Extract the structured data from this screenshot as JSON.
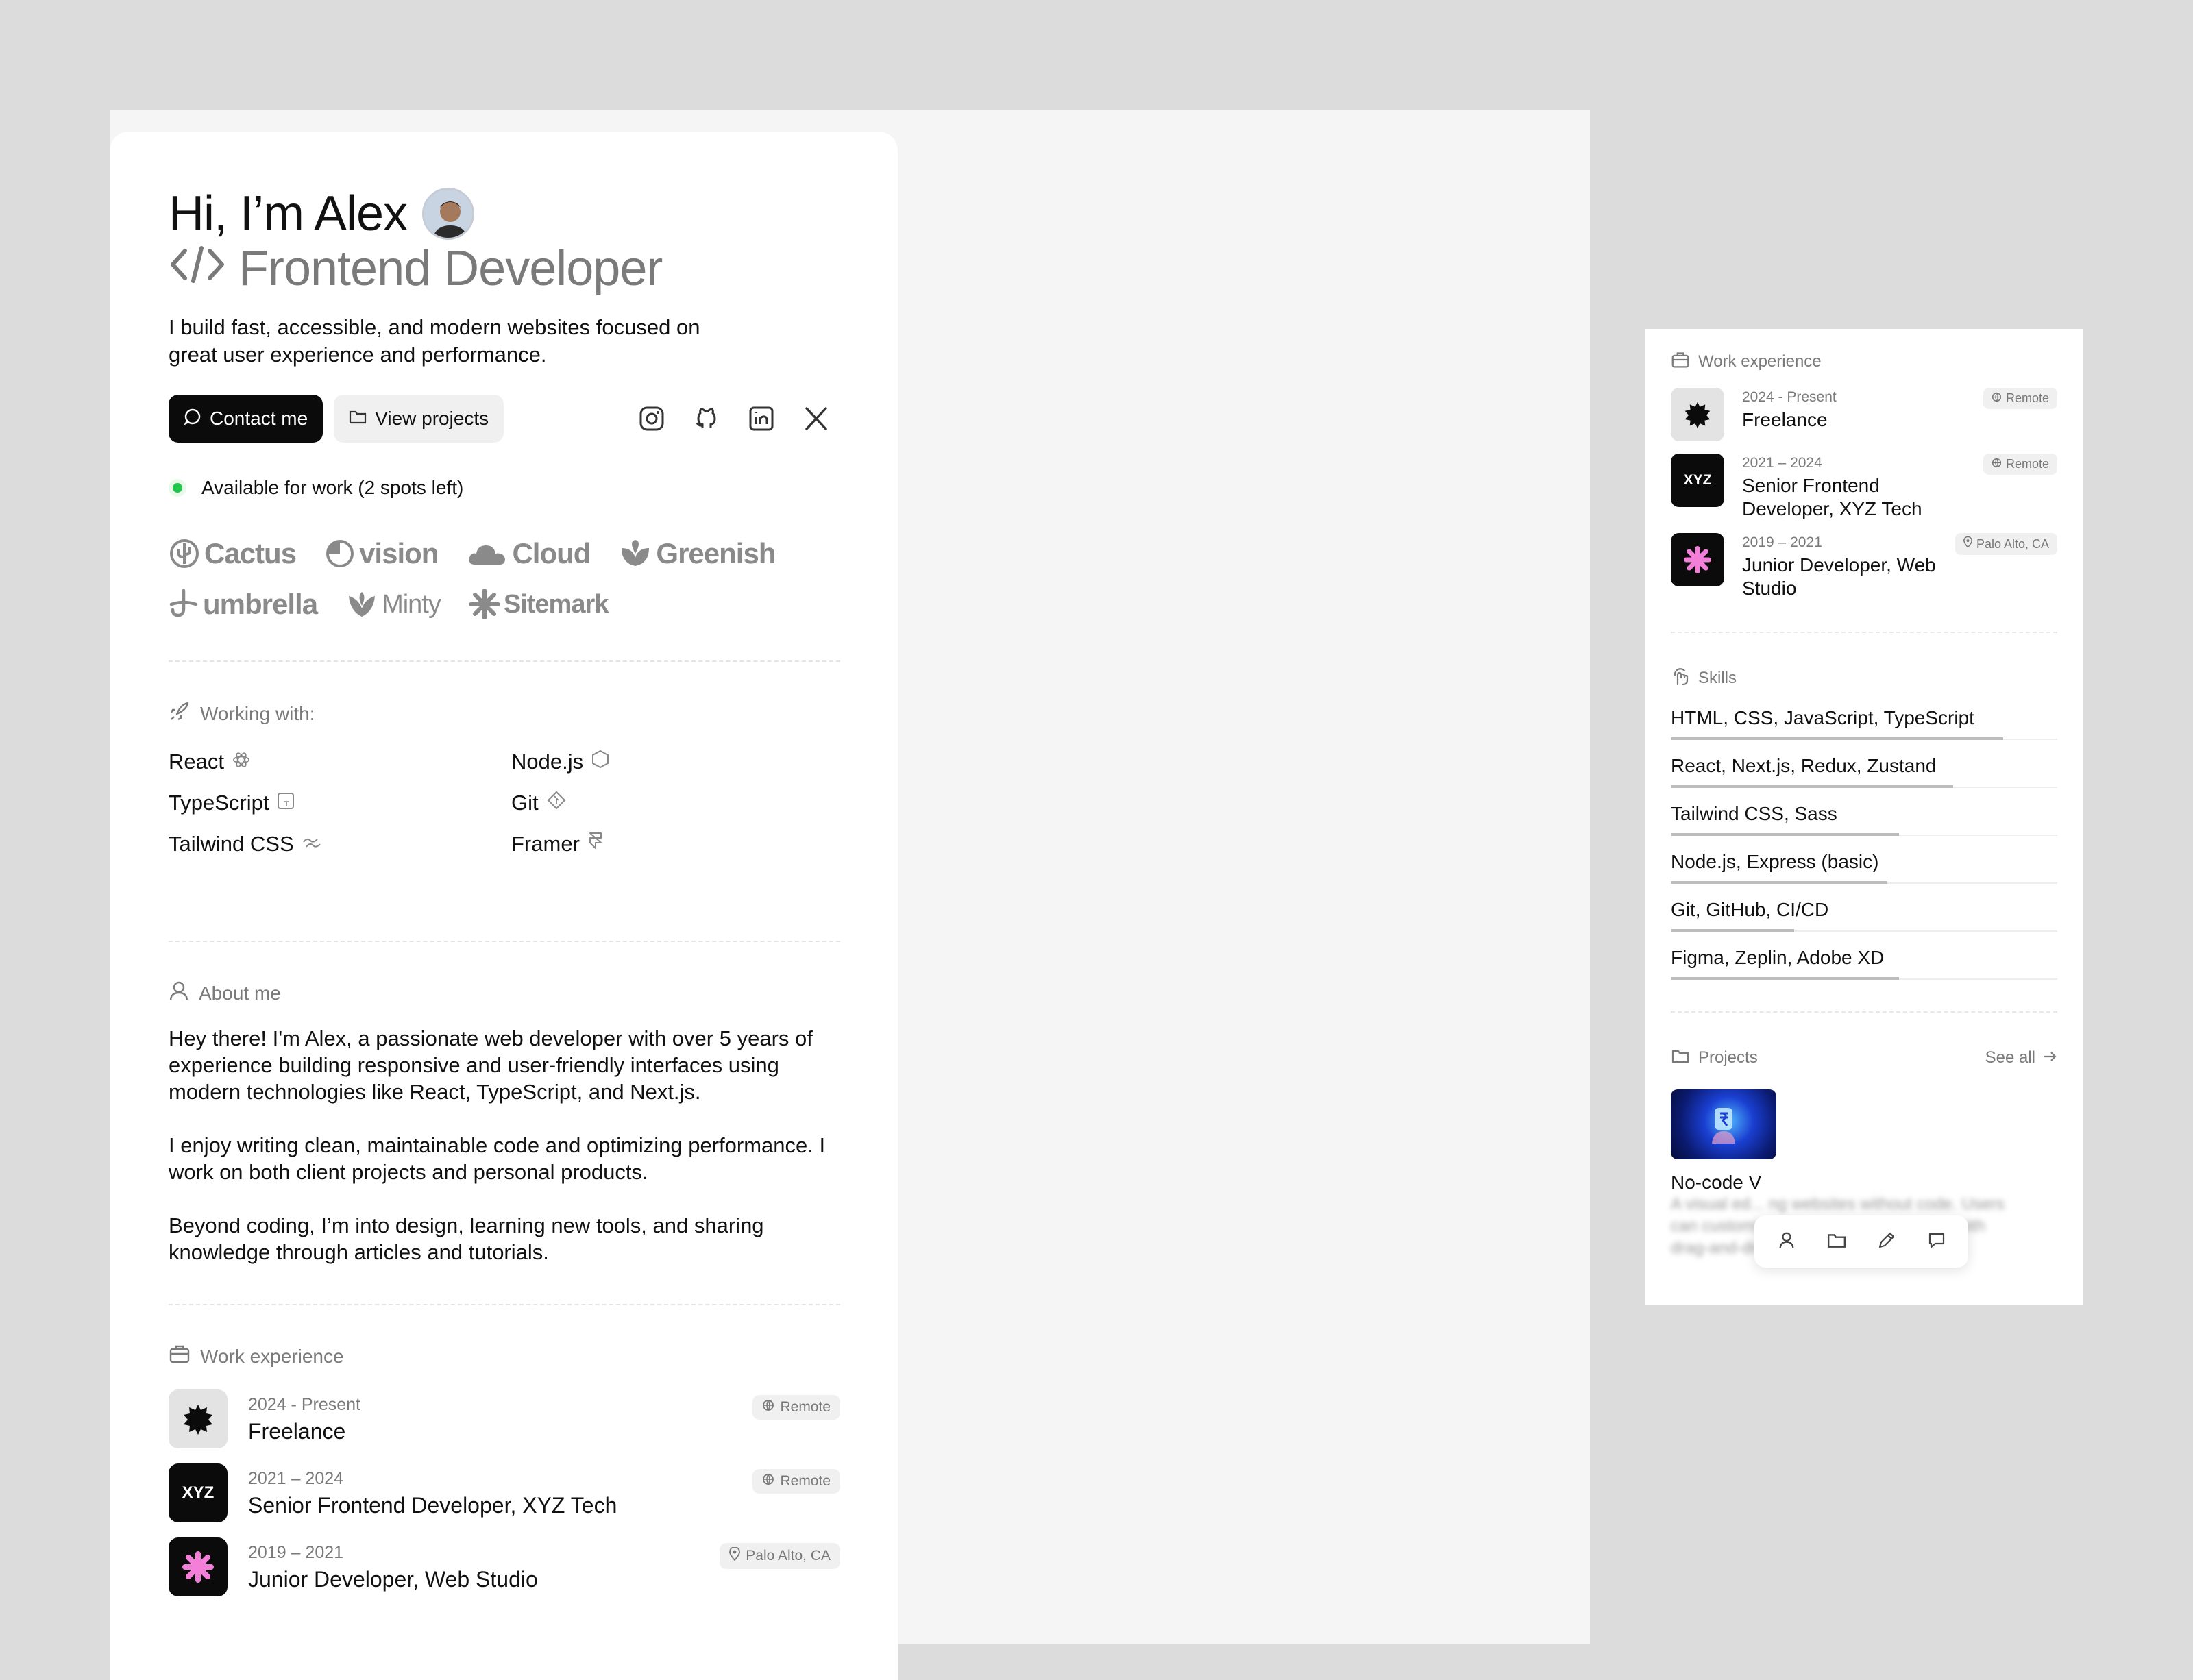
{
  "hero": {
    "greeting": "Hi, I’m Alex",
    "role": "Frontend Developer",
    "intro": "I build fast, accessible, and modern websites focused on great user experience and performance.",
    "contact_label": "Contact me",
    "projects_label": "View projects",
    "social_icons": [
      "instagram-icon",
      "github-icon",
      "linkedin-icon",
      "x-icon"
    ]
  },
  "availability": {
    "text": "Available for work (2 spots left)",
    "color": "#22c64d"
  },
  "clients": [
    "Cactus",
    "vision",
    "Cloud",
    "Greenish",
    "umbrella",
    "Minty",
    "Sitemark"
  ],
  "working_with": {
    "title": "Working with:",
    "items": [
      "React",
      "Node.js",
      "TypeScript",
      "Git",
      "Tailwind CSS",
      "Framer"
    ]
  },
  "about": {
    "title": "About me",
    "p1": "Hey there! I'm Alex, a passionate web developer with over 5 years of experience building responsive and user-friendly interfaces using modern technologies like React, TypeScript, and Next.js.",
    "p2": "I enjoy writing clean, maintainable code and optimizing performance. I work on both client projects and personal products.",
    "p3": "Beyond coding, I’m into design, learning new tools, and sharing knowledge through articles and tutorials."
  },
  "work": {
    "title": "Work experience",
    "items": [
      {
        "date": "2024 - Present",
        "title": "Freelance",
        "badge": "Remote",
        "logo": ""
      },
      {
        "date": "2021 – 2024",
        "title": "Senior Frontend Developer, XYZ Tech",
        "badge": "Remote",
        "logo": "XYZ"
      },
      {
        "date": "2019 – 2021",
        "title": "Junior Developer, Web Studio",
        "badge": "Palo Alto, CA",
        "logo": ""
      }
    ]
  },
  "panel": {
    "work_title": "Work experience",
    "work": [
      {
        "date": "2024 - Present",
        "title": "Freelance",
        "badge": "Remote"
      },
      {
        "date": "2021 – 2024",
        "title": "Senior Frontend Developer, XYZ Tech",
        "badge": "Remote",
        "logo": "XYZ"
      },
      {
        "date": "2019 – 2021",
        "title": "Junior Developer, Web Studio",
        "badge": "Palo Alto, CA"
      }
    ],
    "skills_title": "Skills",
    "skills": [
      {
        "label": "HTML, CSS, JavaScript, TypeScript",
        "level": 0.86
      },
      {
        "label": "React, Next.js, Redux, Zustand",
        "level": 0.73
      },
      {
        "label": "Tailwind CSS, Sass",
        "level": 0.59
      },
      {
        "label": "Node.js, Express (basic)",
        "level": 0.56
      },
      {
        "label": "Git, GitHub, CI/CD",
        "level": 0.32
      },
      {
        "label": "Figma, Zeplin, Adobe XD",
        "level": 0.59
      }
    ],
    "projects_title": "Projects",
    "see_all": "See all",
    "project_title": "No-code V",
    "project_desc": "A visual ed... ng websites without code. Users can customize layouts, text, and styles with drag-and-drop tools"
  },
  "colors": {
    "accent_pink": "#f47fd8",
    "dark": "#0b0b0b"
  }
}
